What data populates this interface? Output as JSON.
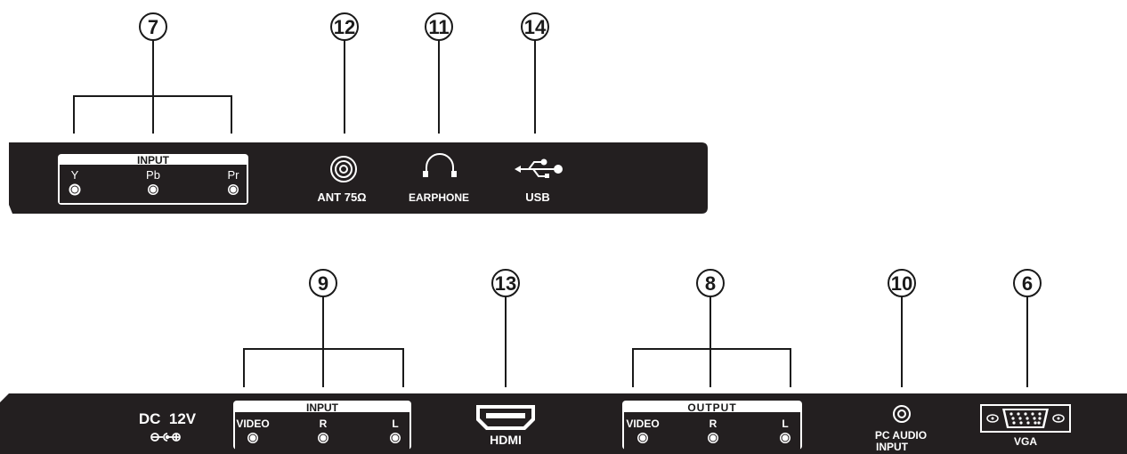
{
  "callouts": {
    "c7": "7",
    "c12": "12",
    "c11": "11",
    "c14": "14",
    "c9": "9",
    "c13": "13",
    "c8": "8",
    "c10": "10",
    "c6": "6"
  },
  "top_panel": {
    "component_input": {
      "title": "INPUT",
      "jacks": [
        "Y",
        "Pb",
        "Pr"
      ]
    },
    "antenna_label": "ANT 75Ω",
    "earphone_label": "EARPHONE",
    "usb_label": "USB"
  },
  "bottom_panel": {
    "dc_label": "DC  12V",
    "av_input": {
      "title": "INPUT",
      "jacks": [
        "VIDEO",
        "R",
        "L"
      ]
    },
    "hdmi_label": "HDMI",
    "av_output": {
      "title": "OUTPUT",
      "jacks": [
        "VIDEO",
        "R",
        "L"
      ]
    },
    "pc_audio_label_1": "PC AUDIO",
    "pc_audio_label_2": "INPUT",
    "vga_label": "VGA"
  }
}
